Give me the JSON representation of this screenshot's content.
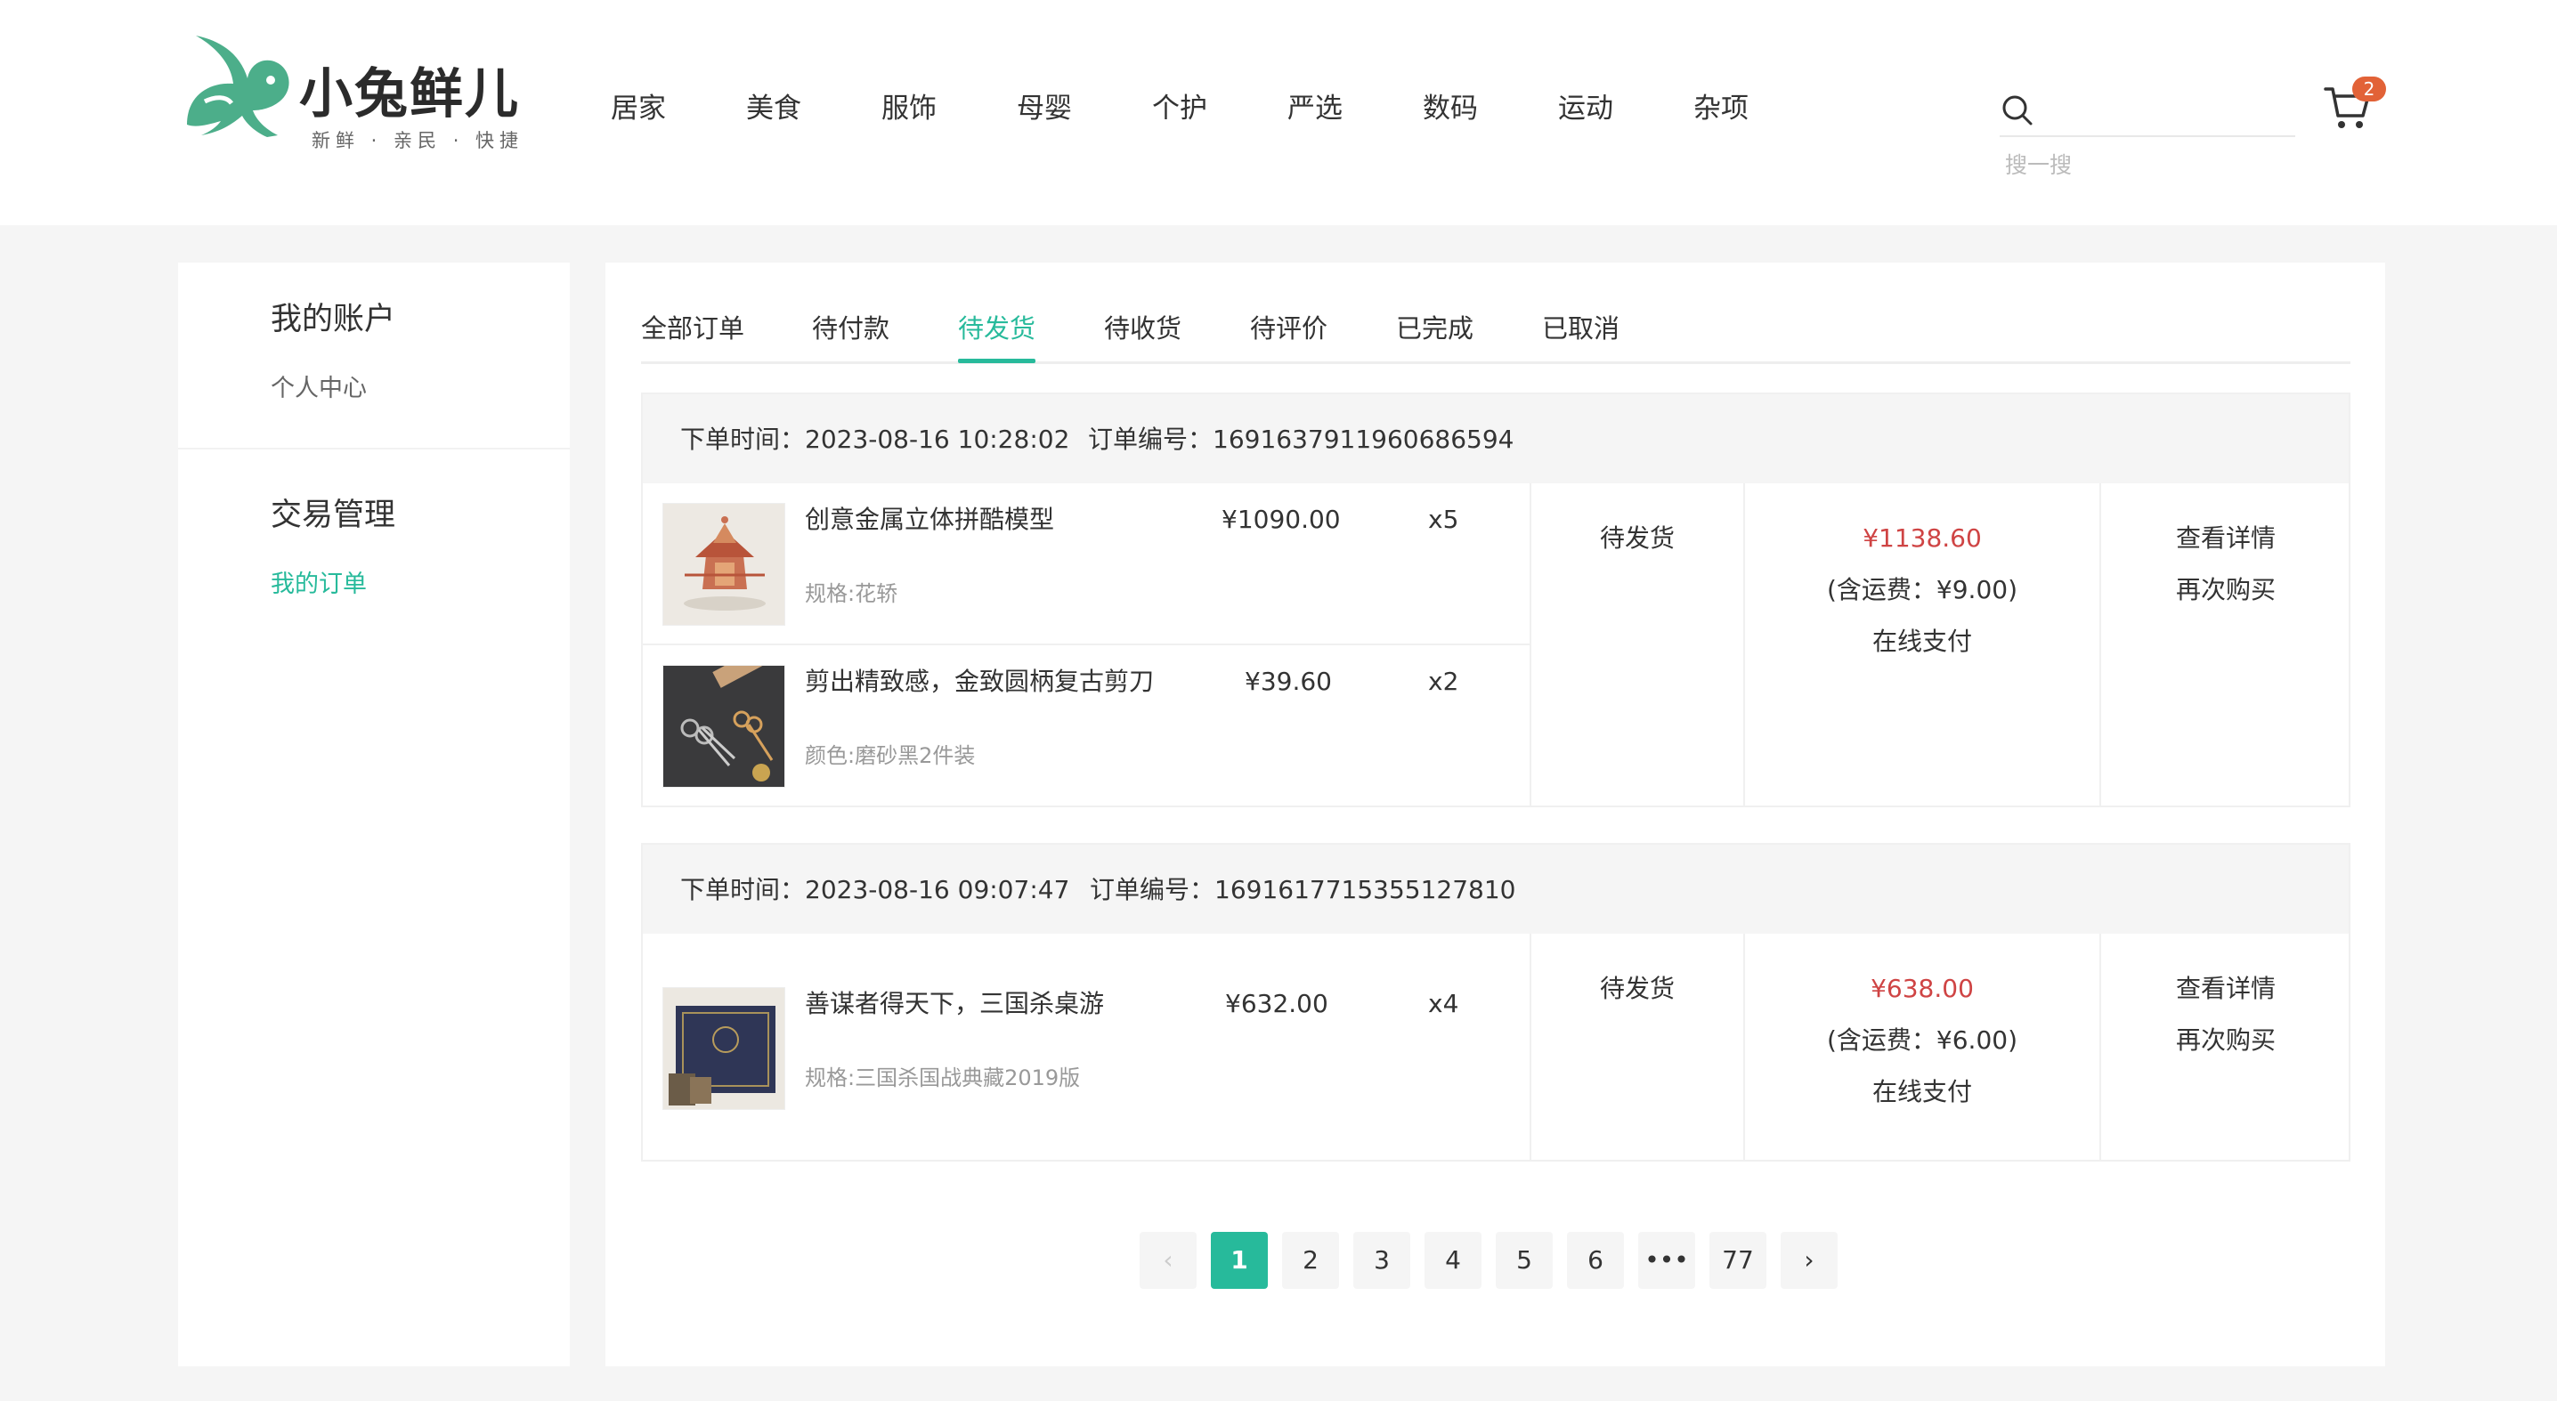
{
  "brand": {
    "name": "小兔鲜儿",
    "slogan": "新鲜 · 亲民 · 快捷",
    "accent": "#27ba9b",
    "price_color": "#cf4444",
    "badge_color": "#e26237"
  },
  "nav": {
    "items": [
      "居家",
      "美食",
      "服饰",
      "母婴",
      "个护",
      "严选",
      "数码",
      "运动",
      "杂项"
    ]
  },
  "search": {
    "placeholder": "搜一搜",
    "icon": "search-icon"
  },
  "cart": {
    "icon": "cart-icon",
    "count": "2"
  },
  "sidebar": {
    "groups": [
      {
        "title": "我的账户",
        "links": [
          "个人中心"
        ]
      },
      {
        "title": "交易管理",
        "links": [
          "我的订单"
        ],
        "active": "我的订单"
      }
    ]
  },
  "tabs": {
    "items": [
      "全部订单",
      "待付款",
      "待发货",
      "待收货",
      "待评价",
      "已完成",
      "已取消"
    ],
    "active": "待发货"
  },
  "orders": [
    {
      "time_label": "下单时间：",
      "time": "2023-08-16 10:28:02",
      "id_label": "订单编号：",
      "id": "1691637911960686594",
      "goods": [
        {
          "name": "创意金属立体拼酷模型",
          "spec": "规格:花轿",
          "price": "¥1090.00",
          "qty": "x5",
          "image": "metal-model-photo"
        },
        {
          "name": "剪出精致感，金致圆柄复古剪刀",
          "spec": "颜色:磨砂黑2件装",
          "price": "¥39.60",
          "qty": "x2",
          "image": "scissors-photo"
        }
      ],
      "status": "待发货",
      "pay_amount": "¥1138.60",
      "freight": "(含运费：¥9.00)",
      "pay_method": "在线支付",
      "actions": [
        "查看详情",
        "再次购买"
      ]
    },
    {
      "time_label": "下单时间：",
      "time": "2023-08-16 09:07:47",
      "id_label": "订单编号：",
      "id": "1691617715355127810",
      "goods": [
        {
          "name": "善谋者得天下，三国杀桌游",
          "spec": "规格:三国杀国战典藏2019版",
          "price": "¥632.00",
          "qty": "x4",
          "image": "board-game-box-photo"
        }
      ],
      "status": "待发货",
      "pay_amount": "¥638.00",
      "freight": "(含运费：¥6.00)",
      "pay_method": "在线支付",
      "actions": [
        "查看详情",
        "再次购买"
      ]
    }
  ],
  "pagination": {
    "prev": "‹",
    "pages": [
      "1",
      "2",
      "3",
      "4",
      "5",
      "6",
      "•••",
      "77"
    ],
    "current": "1",
    "next": "›"
  }
}
